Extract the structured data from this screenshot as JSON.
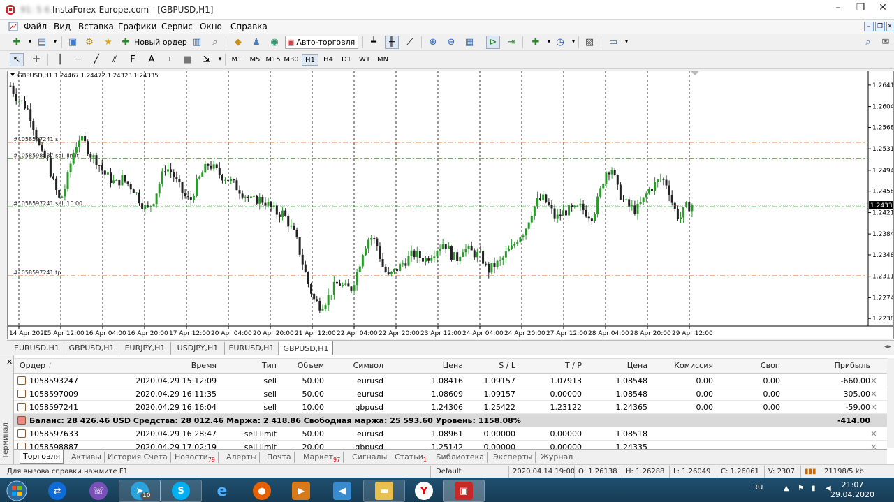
{
  "window": {
    "title_masked": "91: 5 6",
    "title": "InstaForex-Europe.com - [GBPUSD,H1]",
    "controls": [
      "–",
      "❐",
      "✕"
    ],
    "mdi_controls": [
      "–",
      "❐",
      "✕"
    ]
  },
  "menu": [
    "Файл",
    "Вид",
    "Вставка",
    "Графики",
    "Сервис",
    "Окно",
    "Справка"
  ],
  "toolbar": {
    "new_order": "Новый ордер",
    "autotrading": "Авто-торговля"
  },
  "periods": [
    "M1",
    "M5",
    "M15",
    "M30",
    "H1",
    "H4",
    "D1",
    "W1",
    "MN"
  ],
  "active_period": "H1",
  "chart_data": {
    "type": "candlestick",
    "symbol_header": "GBPUSD,H1  1.24467 1.24472 1.24323 1.24335",
    "current_price": "1.24335",
    "y_ticks": [
      "1.26410",
      "1.26040",
      "1.25680",
      "1.25310",
      "1.24940",
      "1.24580",
      "1.24210",
      "1.23840",
      "1.23480",
      "1.23110",
      "1.22740",
      "1.22380"
    ],
    "x_ticks": [
      "14 Apr 2020",
      "15 Apr 12:00",
      "16 Apr 04:00",
      "16 Apr 20:00",
      "17 Apr 12:00",
      "20 Apr 04:00",
      "20 Apr 20:00",
      "21 Apr 12:00",
      "22 Apr 04:00",
      "22 Apr 20:00",
      "23 Apr 12:00",
      "24 Apr 04:00",
      "24 Apr 20:00",
      "27 Apr 12:00",
      "28 Apr 04:00",
      "28 Apr 20:00",
      "29 Apr 12:00"
    ],
    "ylim": [
      1.2225,
      1.2665
    ],
    "levels": [
      {
        "label": "#1058597241 sl",
        "price": 1.2542,
        "color": "#e58a4e"
      },
      {
        "label": "#1058598887 sell limit",
        "price": 1.2514,
        "color": "#3a9a3a"
      },
      {
        "label": "#1058597241 sell 10.00",
        "price": 1.2431,
        "color": "#3a9a3a"
      },
      {
        "label": "#1058597241 tp",
        "price": 1.2312,
        "color": "#e58a4e"
      }
    ],
    "close_path": [
      1.264,
      1.262,
      1.261,
      1.2595,
      1.256,
      1.252,
      1.251,
      1.247,
      1.244,
      1.247,
      1.252,
      1.255,
      1.254,
      1.252,
      1.251,
      1.249,
      1.248,
      1.247,
      1.248,
      1.247,
      1.246,
      1.244,
      1.2425,
      1.244,
      1.247,
      1.25,
      1.249,
      1.247,
      1.245,
      1.244,
      1.247,
      1.249,
      1.2505,
      1.2495,
      1.2485,
      1.248,
      1.247,
      1.246,
      1.245,
      1.244,
      1.2445,
      1.244,
      1.243,
      1.242,
      1.242,
      1.24,
      1.238,
      1.234,
      1.23,
      1.227,
      1.226,
      1.227,
      1.229,
      1.23,
      1.229,
      1.229,
      1.232,
      1.236,
      1.238,
      1.237,
      1.233,
      1.231,
      1.232,
      1.233,
      1.234,
      1.235,
      1.2345,
      1.234,
      1.235,
      1.236,
      1.237,
      1.235,
      1.234,
      1.236,
      1.2355,
      1.235,
      1.2345,
      1.232,
      1.233,
      1.2335,
      1.235,
      1.236,
      1.238,
      1.239,
      1.242,
      1.244,
      1.2445,
      1.243,
      1.241,
      1.242,
      1.2425,
      1.2425,
      1.243,
      1.242,
      1.2415,
      1.245,
      1.249,
      1.25,
      1.246,
      1.244,
      1.243,
      1.2425,
      1.244,
      1.246,
      1.247,
      1.248,
      1.247,
      1.243,
      1.241,
      1.243,
      1.2434
    ],
    "close_x_range": [
      0,
      980
    ]
  },
  "chart_tabs": [
    "EURUSD,H1",
    "GBPUSD,H1",
    "EURJPY,H1",
    "USDJPY,H1",
    "EURUSD,H1",
    "GBPUSD,H1"
  ],
  "active_chart_tab": 5,
  "terminal": {
    "side_label": "Терминал",
    "columns": [
      "Ордер",
      "/",
      "Время",
      "Тип",
      "Объем",
      "Символ",
      "Цена",
      "S / L",
      "T / P",
      "Цена",
      "Комиссия",
      "Своп",
      "Прибыль"
    ],
    "rows": [
      [
        "1058593247",
        "2020.04.29 15:12:09",
        "sell",
        "50.00",
        "eurusd",
        "1.08416",
        "1.09157",
        "1.07913",
        "1.08548",
        "0.00",
        "0.00",
        "-660.00"
      ],
      [
        "1058597009",
        "2020.04.29 16:11:35",
        "sell",
        "50.00",
        "eurusd",
        "1.08609",
        "1.09157",
        "0.00000",
        "1.08548",
        "0.00",
        "0.00",
        "305.00"
      ],
      [
        "1058597241",
        "2020.04.29 16:16:04",
        "sell",
        "10.00",
        "gbpusd",
        "1.24306",
        "1.25422",
        "1.23122",
        "1.24365",
        "0.00",
        "0.00",
        "-59.00"
      ]
    ],
    "balance_line": "Баланс: 28 426.46 USD  Средства: 28 012.46  Маржа: 2 418.86  Свободная маржа: 25 593.60  Уровень: 1158.08%",
    "balance_total": "-414.00",
    "pending": [
      [
        "1058597633",
        "2020.04.29 16:28:47",
        "sell limit",
        "50.00",
        "eurusd",
        "1.08961",
        "0.00000",
        "0.00000",
        "1.08518"
      ],
      [
        "1058598887",
        "2020.04.29 17:02:19",
        "sell limit",
        "20.00",
        "gbpusd",
        "1.25142",
        "0.00000",
        "0.00000",
        "1.24335"
      ]
    ],
    "tabs": [
      {
        "label": "Торговля",
        "badge": ""
      },
      {
        "label": "Активы",
        "badge": ""
      },
      {
        "label": "История Счета",
        "badge": ""
      },
      {
        "label": "Новости",
        "badge": "79"
      },
      {
        "label": "Алерты",
        "badge": ""
      },
      {
        "label": "Почта",
        "badge": ""
      },
      {
        "label": "Маркет",
        "badge": "97"
      },
      {
        "label": "Сигналы",
        "badge": ""
      },
      {
        "label": "Статьи",
        "badge": "1"
      },
      {
        "label": "Библиотека",
        "badge": ""
      },
      {
        "label": "Эксперты",
        "badge": ""
      },
      {
        "label": "Журнал",
        "badge": ""
      }
    ]
  },
  "status": {
    "help": "Для вызова справки нажмите F1",
    "profile": "Default",
    "datetime": "2020.04.14 19:00",
    "open": "O: 1.26138",
    "high": "H: 1.26288",
    "low": "L: 1.26049",
    "close": "C: 1.26061",
    "volume": "V: 2307",
    "traffic": "21198/5 kb"
  },
  "taskbar": {
    "lang": "RU",
    "time": "21:07",
    "date": "29.04.2020",
    "telegram_badge": "10"
  },
  "colors": {
    "bull": "#2a9a2a",
    "bear": "#222222",
    "grid": "#000000"
  }
}
